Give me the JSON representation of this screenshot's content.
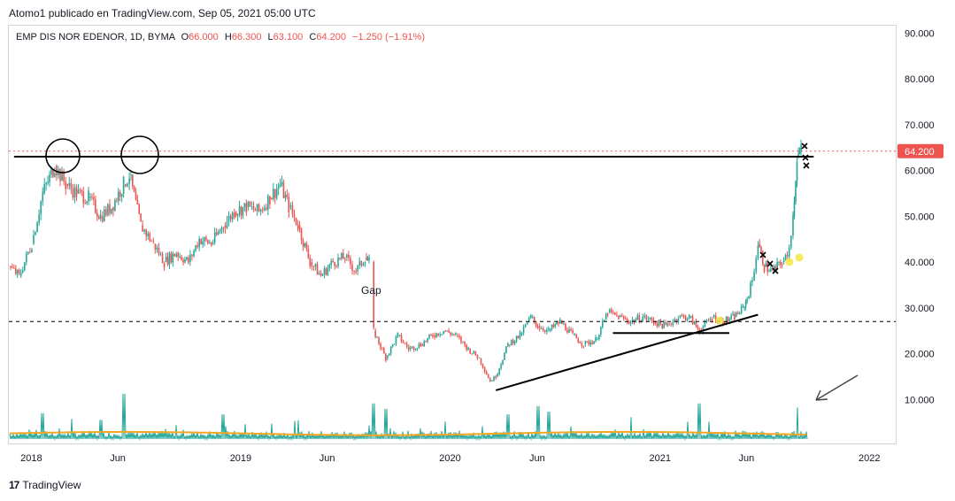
{
  "header": {
    "credit": "Atomo1 publicado en TradingView.com, Sep 05, 2021 05:00 UTC"
  },
  "legend": {
    "symbol": "EMP DIS NOR EDENOR, 1D, BYMA",
    "o_label": "O",
    "o_value": "66.000",
    "h_label": "H",
    "h_value": "66.300",
    "l_label": "L",
    "l_value": "63.100",
    "c_label": "C",
    "c_value": "64.200",
    "change": "−1.250 (−1.91%)"
  },
  "footer": {
    "brand": "TradingView",
    "logo_glyph": "17"
  },
  "annotations": {
    "gap": "Gap"
  },
  "colors": {
    "up": "#26a69a",
    "down": "#ef5350",
    "volume": "#26a69a",
    "volume_ma": "#f5a623",
    "price_line": "#ef5350",
    "line": "#000000",
    "yellow_mark": "#f7e542"
  },
  "chart_data": {
    "type": "candlestick",
    "title": "EMP DIS NOR EDENOR, 1D, BYMA",
    "ohlc_last": {
      "open": 66.0,
      "high": 66.3,
      "low": 63.1,
      "close": 64.2,
      "change": -1.25,
      "change_pct": -1.91
    },
    "last_price_label": "64.200",
    "y_ticks": [
      "90.000",
      "80.000",
      "70.000",
      "60.000",
      "50.000",
      "40.000",
      "30.000",
      "20.000",
      "10.000"
    ],
    "y_tick_values": [
      90,
      80,
      70,
      60,
      50,
      40,
      30,
      20,
      10
    ],
    "ylim": [
      0,
      93
    ],
    "x_ticks": [
      "2018",
      "Jun",
      "2019",
      "Jun",
      "2020",
      "Jun",
      "2021",
      "Jun",
      "2022"
    ],
    "x_tick_dates": [
      "2018-01-01",
      "2018-06-01",
      "2019-01-01",
      "2019-06-01",
      "2020-01-01",
      "2020-06-01",
      "2021-01-01",
      "2021-06-01",
      "2022-01-01"
    ],
    "xlim": [
      "2017-11-22",
      "2022-02-15"
    ],
    "price_series": {
      "dates": [
        "2017-11-22",
        "2017-12-10",
        "2018-01-01",
        "2018-01-20",
        "2018-02-10",
        "2018-03-01",
        "2018-03-20",
        "2018-04-10",
        "2018-05-01",
        "2018-05-20",
        "2018-06-10",
        "2018-06-20",
        "2018-07-10",
        "2018-08-01",
        "2018-08-20",
        "2018-09-10",
        "2018-10-01",
        "2018-10-20",
        "2018-11-10",
        "2018-12-01",
        "2018-12-20",
        "2019-01-10",
        "2019-02-01",
        "2019-02-20",
        "2019-03-10",
        "2019-03-25",
        "2019-04-10",
        "2019-05-01",
        "2019-05-20",
        "2019-06-10",
        "2019-07-01",
        "2019-07-20",
        "2019-08-05",
        "2019-08-12",
        "2019-08-20",
        "2019-09-10",
        "2019-10-01",
        "2019-10-20",
        "2019-11-10",
        "2019-12-01",
        "2019-12-20",
        "2020-01-10",
        "2020-02-01",
        "2020-02-20",
        "2020-03-10",
        "2020-03-20",
        "2020-04-10",
        "2020-05-01",
        "2020-05-20",
        "2020-06-01",
        "2020-06-20",
        "2020-07-10",
        "2020-08-01",
        "2020-08-20",
        "2020-09-10",
        "2020-10-01",
        "2020-10-20",
        "2020-11-10",
        "2020-12-01",
        "2020-12-20",
        "2021-01-10",
        "2021-02-01",
        "2021-02-20",
        "2021-03-10",
        "2021-04-01",
        "2021-04-20",
        "2021-05-10",
        "2021-05-25",
        "2021-06-01",
        "2021-06-10",
        "2021-06-20",
        "2021-07-01",
        "2021-07-15",
        "2021-08-01",
        "2021-08-10",
        "2021-08-20",
        "2021-08-27",
        "2021-09-03"
      ],
      "close": [
        39,
        37,
        44,
        55,
        61,
        57,
        55,
        54,
        50,
        52,
        57,
        59,
        48,
        44,
        40,
        42,
        40,
        45,
        44,
        48,
        51,
        52,
        51,
        54,
        57,
        52,
        48,
        40,
        37,
        40,
        41,
        38,
        41,
        40,
        25,
        19,
        24,
        21,
        22,
        24,
        25,
        24,
        21,
        19,
        14,
        15,
        22,
        24,
        28,
        26,
        25,
        27,
        24,
        22,
        23,
        29,
        28,
        27,
        28,
        27,
        26,
        28,
        28,
        25,
        28,
        27,
        28,
        30,
        32,
        36,
        44,
        39,
        38,
        40,
        41,
        50,
        63,
        64.2
      ]
    },
    "volume_series": {
      "note_ma": "orange moving average of volume",
      "spikes": [
        {
          "date": "2018-01-20",
          "value": 9.5
        },
        {
          "date": "2018-05-01",
          "value": 7
        },
        {
          "date": "2018-06-10",
          "value": 16.5
        },
        {
          "date": "2018-12-01",
          "value": 9
        },
        {
          "date": "2019-08-20",
          "value": 13
        },
        {
          "date": "2019-09-10",
          "value": 11
        },
        {
          "date": "2020-04-10",
          "value": 9
        },
        {
          "date": "2020-06-01",
          "value": 12
        },
        {
          "date": "2020-06-20",
          "value": 10
        },
        {
          "date": "2020-11-10",
          "value": 8
        },
        {
          "date": "2021-03-10",
          "value": 13
        },
        {
          "date": "2021-08-27",
          "value": 11.5
        }
      ]
    },
    "resistance_line": {
      "value": 63.0,
      "from": "2017-12-01",
      "to": "2021-09-25"
    },
    "support_dashed": {
      "value": 27.0
    },
    "trendline": {
      "from": {
        "date": "2020-03-20",
        "value": 12
      },
      "to": {
        "date": "2021-06-20",
        "value": 28.5
      }
    },
    "flat_line": {
      "value": 24.5,
      "from": "2020-10-10",
      "to": "2021-05-01"
    }
  }
}
